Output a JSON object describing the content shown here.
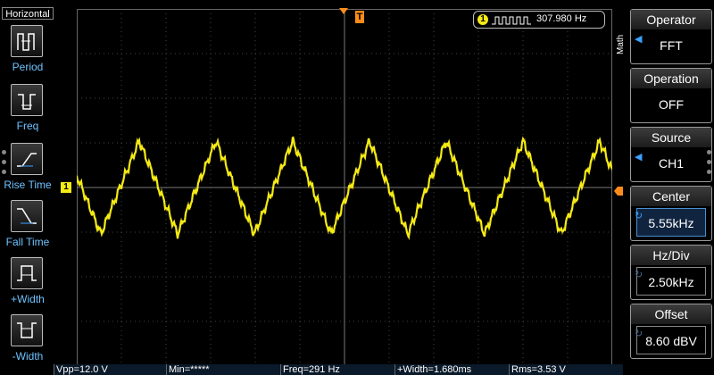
{
  "left_panel": {
    "title": "Horizontal",
    "buttons": [
      {
        "label": "Period",
        "icon": "period-icon"
      },
      {
        "label": "Freq",
        "icon": "frequency-icon"
      },
      {
        "label": "Rise Time",
        "icon": "rise-time-icon"
      },
      {
        "label": "Fall Time",
        "icon": "fall-time-icon"
      },
      {
        "label": "+Width",
        "icon": "positive-width-icon"
      },
      {
        "label": "-Width",
        "icon": "negative-width-icon"
      }
    ]
  },
  "markers": {
    "trigger_top": "T",
    "channel_left": "1"
  },
  "readout": {
    "channel_badge": "1",
    "frequency": "307.980 Hz"
  },
  "math_tab": "Math",
  "right_panel": [
    {
      "header": "Operator",
      "value": "FFT",
      "has_arrow": true
    },
    {
      "header": "Operation",
      "value": "OFF",
      "has_arrow": false
    },
    {
      "header": "Source",
      "value": "CH1",
      "has_arrow": true
    },
    {
      "header": "Center",
      "value": "5.55kHz",
      "highlight": true
    },
    {
      "header": "Hz/Div",
      "value": "2.50kHz"
    },
    {
      "header": "Offset",
      "value": "8.60 dBV"
    }
  ],
  "status": {
    "vpp": "Vpp=12.0 V",
    "min": "Min=*****",
    "freq": "Freq=291 Hz",
    "width": "+Width=1.680ms",
    "rms": "Rms=3.53 V"
  },
  "colors": {
    "trace": "#f5ea14",
    "accent": "#3ea0ff",
    "marker": "#ff8c1a"
  }
}
